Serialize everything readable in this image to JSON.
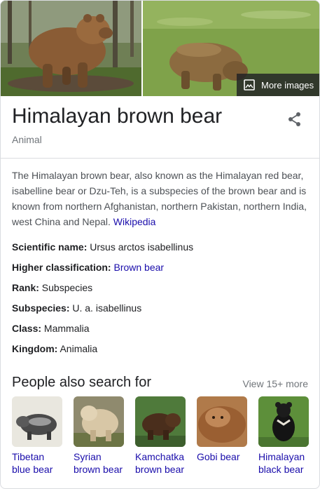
{
  "images": {
    "more_images_label": "More images"
  },
  "entity": {
    "title": "Himalayan brown bear",
    "subtitle": "Animal"
  },
  "description": {
    "text": "The Himalayan brown bear, also known as the Himalayan red bear, isabelline bear or Dzu-Teh, is a subspecies of the brown bear and is known from northern Afghanistan, northern Pakistan, northern India, west China and Nepal.",
    "source_link": "Wikipedia"
  },
  "facts": [
    {
      "label": "Scientific name:",
      "value": "Ursus arctos isabellinus",
      "is_link": false
    },
    {
      "label": "Higher classification:",
      "value": "Brown bear",
      "is_link": true
    },
    {
      "label": "Rank:",
      "value": "Subspecies",
      "is_link": false
    },
    {
      "label": "Subspecies:",
      "value": "U. a. isabellinus",
      "is_link": false
    },
    {
      "label": "Class:",
      "value": "Mammalia",
      "is_link": false
    },
    {
      "label": "Kingdom:",
      "value": "Animalia",
      "is_link": false
    }
  ],
  "people_also_search": {
    "title": "People also search for",
    "more_label": "View 15+ more",
    "items": [
      {
        "label_line1": "Tibetan",
        "label_line2": "blue bear"
      },
      {
        "label_line1": "Syrian",
        "label_line2": "brown bear"
      },
      {
        "label_line1": "Kamchatka",
        "label_line2": "brown bear"
      },
      {
        "label_line1": "Gobi bear",
        "label_line2": ""
      },
      {
        "label_line1": "Himalayan",
        "label_line2": "black bear"
      }
    ]
  },
  "colors": {
    "link": "#1a0dab",
    "muted": "#70757a",
    "text": "#202124",
    "divider": "#dadce0"
  },
  "icons": {
    "share": "share-icon",
    "image": "image-icon"
  }
}
